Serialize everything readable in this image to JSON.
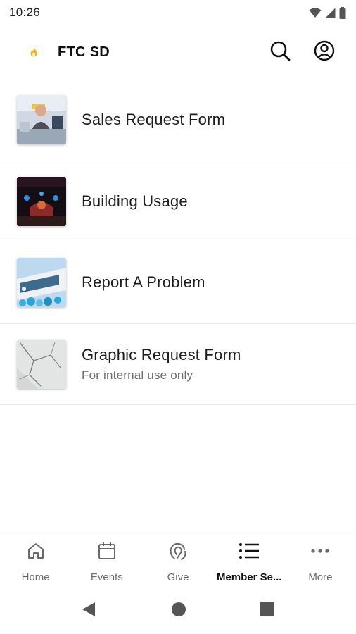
{
  "status_bar": {
    "time": "10:26",
    "icons": [
      "wifi-icon",
      "signal-icon",
      "battery-icon"
    ]
  },
  "header": {
    "app_title": "FTC SD",
    "logo_icon": "flame-logo-icon",
    "logo_color": "#F5B51B",
    "actions": [
      "search-icon",
      "account-icon"
    ]
  },
  "list": {
    "items": [
      {
        "title": "Sales Request Form",
        "subtitle": "",
        "thumbnail": "person-at-table-photo"
      },
      {
        "title": "Building Usage",
        "subtitle": "",
        "thumbnail": "stage-lights-photo"
      },
      {
        "title": "Report A Problem",
        "subtitle": "",
        "thumbnail": "sign-and-balloons-photo"
      },
      {
        "title": "Graphic Request Form",
        "subtitle": "For internal use only",
        "thumbnail": "cracked-wall-photo"
      }
    ]
  },
  "tabs": [
    {
      "label": "Home",
      "icon": "home-icon",
      "active": false
    },
    {
      "label": "Events",
      "icon": "calendar-icon",
      "active": false
    },
    {
      "label": "Give",
      "icon": "give-icon",
      "active": false
    },
    {
      "label": "Member Se...",
      "icon": "list-icon",
      "active": true
    },
    {
      "label": "More",
      "icon": "more-dots-icon",
      "active": false
    }
  ],
  "nav_bar": {
    "buttons": [
      "back-icon",
      "home-circle-icon",
      "recents-square-icon"
    ]
  },
  "colors": {
    "accent": "#F5B51B",
    "text_primary": "#1d1d1d",
    "text_secondary": "#6e6e6e",
    "divider": "#ececec"
  }
}
